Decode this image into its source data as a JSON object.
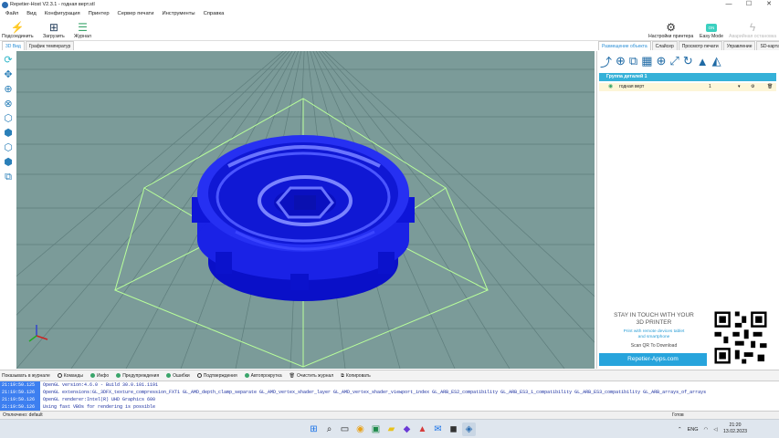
{
  "window": {
    "title": "Repetier-Host V2.3.1 - годная верт.stl",
    "controls": [
      "—",
      "☐",
      "✕"
    ]
  },
  "menu": [
    "Файл",
    "Вид",
    "Конфигурация",
    "Принтер",
    "Сервер печати",
    "Инструменты",
    "Справка"
  ],
  "toolbar": {
    "connect": "Подсоединить",
    "load": "Загрузить",
    "log": "Журнал",
    "printer_settings": "Настройки принтера",
    "easy_mode": "Easy Mode",
    "easy_badge": "ON",
    "emergency": "Аварийная остановка"
  },
  "viewtabs": [
    "3D Вид",
    "График температур"
  ],
  "righttabs": [
    "Размещение объекта",
    "Слайсер",
    "Просмотр печати",
    "Управление",
    "SD-карта"
  ],
  "objects": {
    "group_header": "Группа деталей 1",
    "rows": [
      {
        "name": "годная верт",
        "qty": "1"
      }
    ]
  },
  "promo": {
    "heading_line1": "STAY IN TOUCH WITH YOUR",
    "heading_line2": "3D PRINTER",
    "sub_line1": "Print with remote devices tablet",
    "sub_line2": "and smartphone",
    "scan": "Scan QR To Download",
    "button": "Repetier-Apps.com"
  },
  "logbar": {
    "show_in_log": "Показывать в журнале",
    "commands": "Команды",
    "info": "Инфо",
    "warnings": "Предупреждения",
    "errors": "Ошибки",
    "acks": "Подтверждения",
    "autoscroll": "Автопрокрутка",
    "clear": "Очистить журнал",
    "copy": "Копировать"
  },
  "log": [
    {
      "time": "21:19:50.125",
      "text": "OpenGL version:4.6.0 - Build 30.0.101.1191"
    },
    {
      "time": "21:19:50.126",
      "text": "OpenGL extensions:GL_3DFX_texture_compression_FXT1 GL_AMD_depth_clamp_separate GL_AMD_vertex_shader_layer GL_AMD_vertex_shader_viewport_index GL_ARB_ES2_compatibility GL_ARB_ES3_1_compatibility GL_ARB_ES3_compatibility GL_ARB_arrays_of_arrays"
    },
    {
      "time": "21:19:50.126",
      "text": "OpenGL renderer:Intel(R) UHD Graphics 600"
    },
    {
      "time": "21:19:50.126",
      "text": "Using fast VBOs for rendering is possible"
    }
  ],
  "status": {
    "left": "Отключено: default",
    "right": "Готов"
  },
  "tray": {
    "lang": "ENG",
    "time": "21:20",
    "date": "13.02.2023"
  }
}
